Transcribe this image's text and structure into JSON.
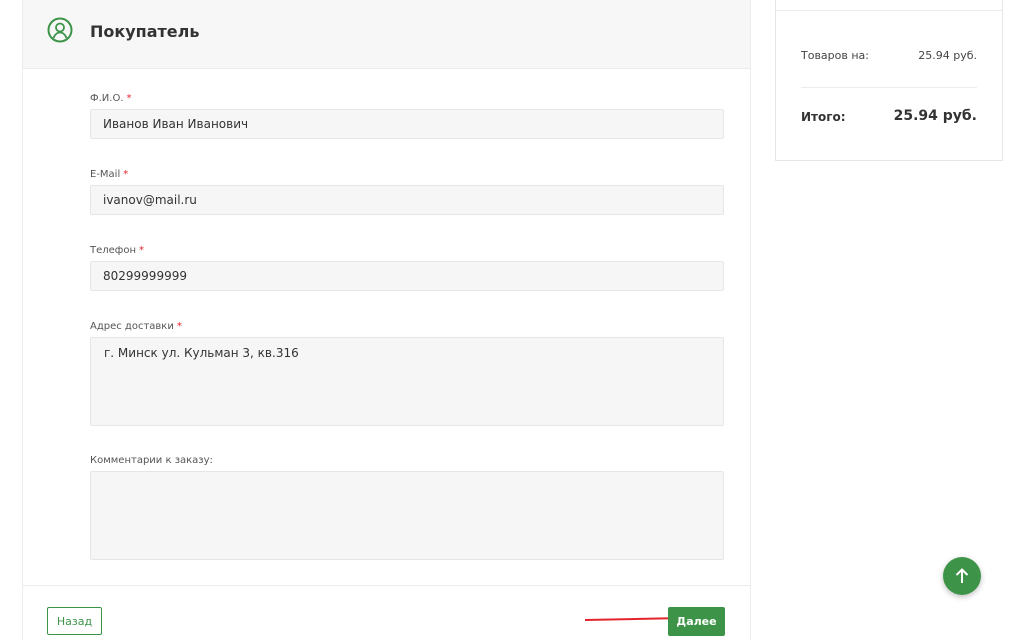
{
  "buyer": {
    "title": "Покупатель",
    "icon": "user-outline-icon",
    "accent_color": "#3d9449"
  },
  "form": {
    "fields": [
      {
        "label": "Ф.И.О.",
        "required": true,
        "value": "Иванов Иван Иванович"
      },
      {
        "label": "E-Mail",
        "required": true,
        "value": "ivanov@mail.ru"
      },
      {
        "label": "Телефон",
        "required": true,
        "value": "80299999999"
      },
      {
        "label": "Адрес доставки",
        "required": true,
        "value": "г. Минск ул. Кульман 3, кв.316"
      },
      {
        "label": "Комментарии к заказу:",
        "required": false,
        "value": ""
      }
    ],
    "required_mark": "*"
  },
  "buttons": {
    "back_label": "Назад",
    "next_label": "Далее"
  },
  "summary": {
    "goods_label": "Товаров на:",
    "goods_value": "25.94 руб.",
    "total_label": "Итого:",
    "total_value": "25.94 руб."
  },
  "scroll_top": {
    "icon": "arrow-up-icon"
  }
}
